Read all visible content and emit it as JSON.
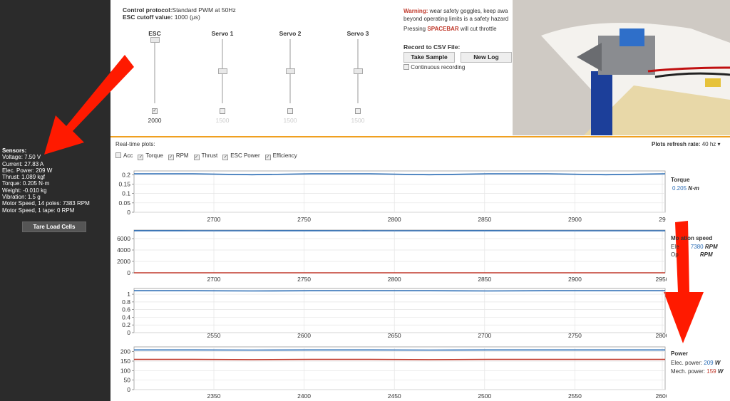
{
  "sensors": {
    "header": "Sensors:",
    "lines": [
      "Voltage: 7.50 V",
      "Current: 27.83 A",
      "Elec. Power: 209 W",
      "Thrust: 1.089 kgf",
      "Torque: 0.205 N·m",
      "Weight: -0.010 kg",
      "Vibration: 1.5 g",
      "Motor Speed, 14 poles: 7383 RPM",
      "Motor Speed, 1 tape: 0 RPM"
    ],
    "tare_label": "Tare Load Cells"
  },
  "control": {
    "protocol_label": "Control protocol:",
    "protocol_value": "Standard PWM at 50Hz",
    "cutoff_label": "ESC cutoff value:",
    "cutoff_value": "1000 (μs)"
  },
  "sliders": [
    {
      "title": "ESC",
      "value": "2000",
      "level": 1.0,
      "checked": true
    },
    {
      "title": "Servo 1",
      "value": "1500",
      "level": 0.5,
      "checked": false
    },
    {
      "title": "Servo 2",
      "value": "1500",
      "level": 0.5,
      "checked": false
    },
    {
      "title": "Servo 3",
      "value": "1500",
      "level": 0.5,
      "checked": false
    }
  ],
  "warning": {
    "label": "Warning:",
    "text1": " wear safety goggles, keep awa",
    "text2": "beyond operating limits is a safety hazard",
    "press": "Pressing ",
    "key": "SPACEBAR",
    "after": " will cut throttle"
  },
  "record": {
    "title": "Record to CSV File:",
    "sample": "Take Sample",
    "newlog": "New Log",
    "continuous": "Continuous recording"
  },
  "plots": {
    "title": "Real-time plots:",
    "options": [
      {
        "label": "Acc",
        "checked": false
      },
      {
        "label": "Torque",
        "checked": true
      },
      {
        "label": "RPM",
        "checked": true
      },
      {
        "label": "Thrust",
        "checked": true
      },
      {
        "label": "ESC Power",
        "checked": true
      },
      {
        "label": "Efficiency",
        "checked": true
      }
    ],
    "refresh_label": "Plots refresh rate:",
    "refresh_value": "40 hz"
  },
  "side": {
    "torque": {
      "title": "Torque",
      "value": "0.205",
      "unit": "N·m"
    },
    "rotation": {
      "title": "Mo   ation speed",
      "l1": "Ele",
      "v1": "7380",
      "u1": "RPM",
      "l2": "Op",
      "u2": "RPM"
    },
    "power": {
      "title": "Power",
      "l1": "Elec. power:",
      "v1": "209",
      "u1": "W",
      "l2": "Mech. power:",
      "v2": "159",
      "u2": "W"
    }
  },
  "colors": {
    "blue": "#2a6cb5",
    "red": "#c0392b",
    "orange": "#f0a020",
    "dark": "#2b2b2b"
  },
  "chart_data": [
    {
      "type": "line",
      "title": "Torque",
      "yticks": [
        "0.2",
        "0.15",
        "0.1",
        "0.05",
        "0"
      ],
      "ylim": [
        0,
        0.22
      ],
      "xticks": [
        "2700",
        "2750",
        "2800",
        "2850",
        "2900",
        "29"
      ],
      "series": [
        {
          "values": [
            0.205,
            0.205,
            0.2,
            0.205,
            0.205,
            0.2,
            0.205,
            0.205,
            0.2,
            0.205
          ]
        }
      ]
    },
    {
      "type": "line",
      "title": "Rotation speed",
      "yticks": [
        "6000",
        "4000",
        "2000",
        "0"
      ],
      "ylim": [
        0,
        7500
      ],
      "xticks": [
        "2700",
        "2750",
        "2800",
        "2850",
        "2900",
        "2950"
      ],
      "series": [
        {
          "values": [
            7383,
            7380,
            7380,
            7383,
            7380,
            7380,
            7383,
            7380,
            7380,
            7380
          ]
        },
        {
          "values": [
            0,
            0,
            0,
            0,
            0,
            0,
            0,
            0,
            0,
            0
          ]
        }
      ]
    },
    {
      "type": "line",
      "title": "Thrust",
      "yticks": [
        "1",
        "0.8",
        "0.6",
        "0.4",
        "0.2",
        "0"
      ],
      "ylim": [
        0,
        1.15
      ],
      "xticks": [
        "2550",
        "2600",
        "2650",
        "2700",
        "2750",
        "2800"
      ],
      "series": [
        {
          "values": [
            1.09,
            1.09,
            1.085,
            1.09,
            1.09,
            1.09,
            1.085,
            1.09,
            1.09,
            1.09
          ]
        }
      ]
    },
    {
      "type": "line",
      "title": "Power",
      "yticks": [
        "200",
        "150",
        "100",
        "50",
        "0"
      ],
      "ylim": [
        0,
        225
      ],
      "xticks": [
        "2350",
        "2400",
        "2450",
        "2500",
        "2550",
        "2600"
      ],
      "series": [
        {
          "values": [
            209,
            209,
            208,
            209,
            209,
            208,
            209,
            209,
            209,
            209
          ]
        },
        {
          "values": [
            159,
            159,
            158,
            159,
            159,
            158,
            159,
            159,
            159,
            159
          ]
        }
      ]
    }
  ]
}
